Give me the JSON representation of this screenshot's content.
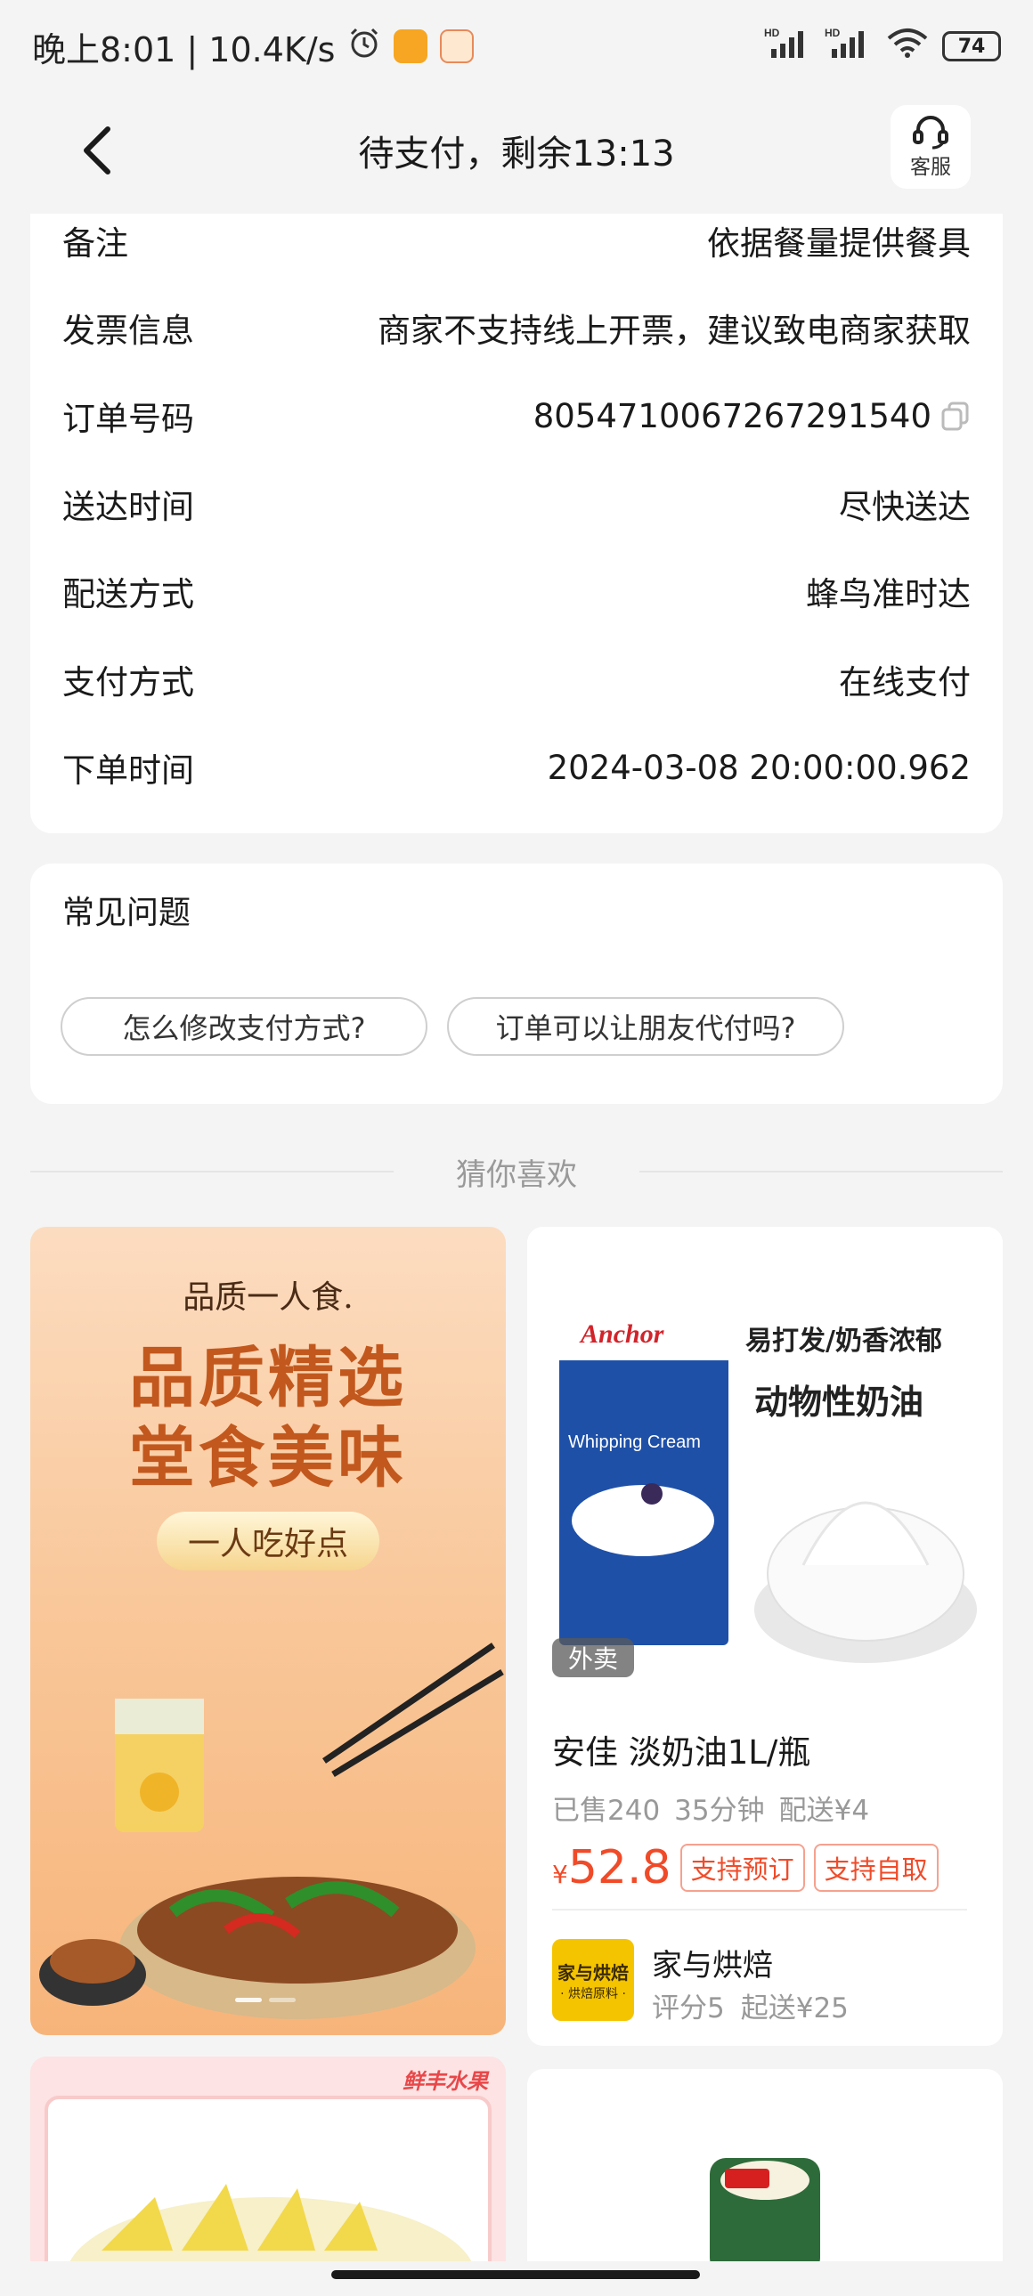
{
  "status_bar": {
    "time_speed": "晚上8:01 | 10.4K/s",
    "network_1": "HD",
    "network_2": "HD",
    "battery": "74"
  },
  "nav": {
    "title": "待支付，剩余13:13",
    "service_label": "客服"
  },
  "order_info": {
    "rows": [
      {
        "label": "备注",
        "value": "依据餐量提供餐具"
      },
      {
        "label": "发票信息",
        "value": "商家不支持线上开票，建议致电商家获取"
      },
      {
        "label": "订单号码",
        "value": "8054710067267291540"
      },
      {
        "label": "送达时间",
        "value": "尽快送达"
      },
      {
        "label": "配送方式",
        "value": "蜂鸟准时达"
      },
      {
        "label": "支付方式",
        "value": "在线支付"
      },
      {
        "label": "下单时间",
        "value": "2024-03-08 20:00:00.962"
      }
    ]
  },
  "faq": {
    "title": "常见问题",
    "chips": [
      "怎么修改支付方式?",
      "订单可以让朋友代付吗?"
    ]
  },
  "recommend": {
    "header": "猜你喜欢"
  },
  "banner": {
    "brand": "品质一人食.",
    "headline_1": "品质精选",
    "headline_2": "堂食美味",
    "pill": "一人吃好点"
  },
  "product": {
    "img_brand": "Anchor",
    "img_product": "Whipping Cream",
    "img_slogan": "易打发/奶香浓郁",
    "img_title": "动物性奶油",
    "tag": "外卖",
    "name": "安佳 淡奶油1L/瓶",
    "sold": "已售240",
    "time": "35分钟",
    "delivery_fee": "配送¥4",
    "price_symbol": "¥",
    "price": "52.8",
    "tag_1": "支持预订",
    "tag_2": "支持自取",
    "shop_logo_1": "家与烘焙",
    "shop_logo_2": "· 烘焙原料 ·",
    "shop_name": "家与烘焙",
    "shop_rating": "评分5",
    "shop_min": "起送¥25"
  },
  "fruit_card": {
    "badge": "鲜丰水果"
  },
  "colors": {
    "accent_red": "#f04b29",
    "banner_orange": "#c2581d",
    "page_bg": "#f4f4f4"
  }
}
